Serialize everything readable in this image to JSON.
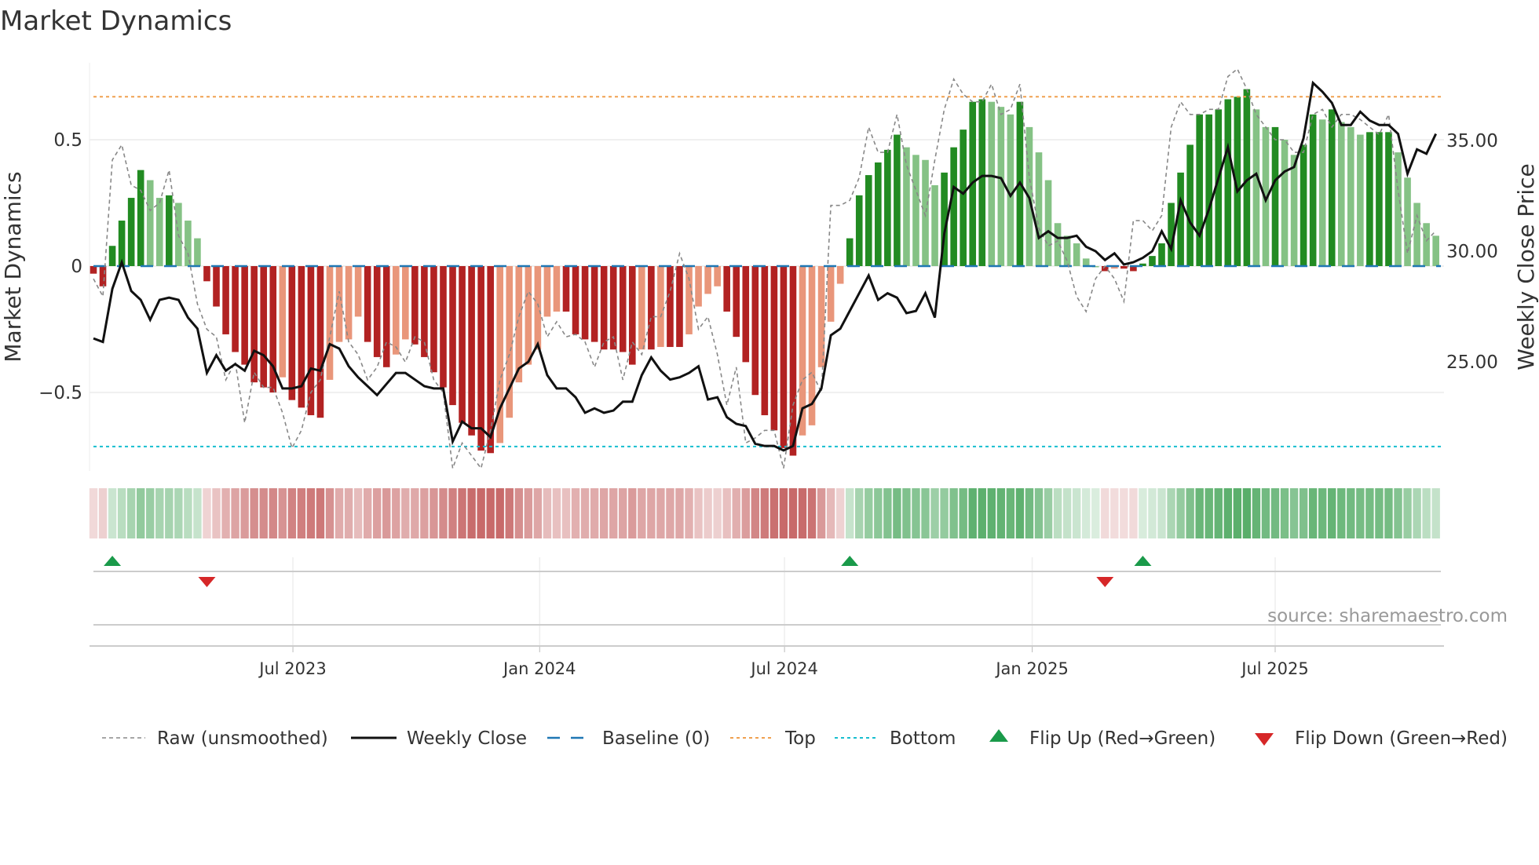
{
  "chart_data": {
    "type": "bar",
    "title": "Market Dynamics",
    "ylabel": "Market Dynamics",
    "y2label": "Weekly Close Price",
    "ylim": [
      -0.82,
      0.82
    ],
    "y2lim": [
      20.5,
      38.4
    ],
    "yticks": [
      {
        "v": 0.5,
        "label": "0.5"
      },
      {
        "v": 0,
        "label": "0"
      },
      {
        "v": -0.5,
        "label": "−0.5"
      }
    ],
    "y2ticks": [
      {
        "v": 35,
        "label": "35.00"
      },
      {
        "v": 30,
        "label": "30.00"
      },
      {
        "v": 25,
        "label": "25.00"
      }
    ],
    "xticks": [
      {
        "week": 21.1,
        "label": "Jul 2023"
      },
      {
        "week": 47.2,
        "label": "Jan 2024"
      },
      {
        "week": 73.1,
        "label": "Jul 2024"
      },
      {
        "week": 99.3,
        "label": "Jan 2025"
      },
      {
        "week": 125.0,
        "label": "Jul 2025"
      }
    ],
    "top": 0.67,
    "bottom": -0.714,
    "momentum": [
      -0.03,
      -0.08,
      0.08,
      0.18,
      0.27,
      0.38,
      0.34,
      0.27,
      0.28,
      0.25,
      0.18,
      0.11,
      -0.06,
      -0.16,
      -0.27,
      -0.34,
      -0.39,
      -0.46,
      -0.48,
      -0.5,
      -0.44,
      -0.53,
      -0.56,
      -0.59,
      -0.6,
      -0.45,
      -0.3,
      -0.29,
      -0.2,
      -0.3,
      -0.36,
      -0.4,
      -0.35,
      -0.29,
      -0.31,
      -0.36,
      -0.42,
      -0.48,
      -0.55,
      -0.62,
      -0.67,
      -0.73,
      -0.74,
      -0.7,
      -0.6,
      -0.46,
      -0.39,
      -0.33,
      -0.2,
      -0.18,
      -0.18,
      -0.27,
      -0.29,
      -0.3,
      -0.33,
      -0.33,
      -0.34,
      -0.39,
      -0.33,
      -0.33,
      -0.32,
      -0.32,
      -0.32,
      -0.27,
      -0.16,
      -0.11,
      -0.08,
      -0.18,
      -0.28,
      -0.38,
      -0.51,
      -0.59,
      -0.65,
      -0.72,
      -0.75,
      -0.67,
      -0.63,
      -0.4,
      -0.22,
      -0.07,
      0.11,
      0.28,
      0.36,
      0.41,
      0.46,
      0.52,
      0.47,
      0.44,
      0.42,
      0.32,
      0.37,
      0.47,
      0.54,
      0.65,
      0.66,
      0.65,
      0.63,
      0.6,
      0.65,
      0.55,
      0.45,
      0.34,
      0.17,
      0.12,
      0.09,
      0.03,
      0.0,
      -0.02,
      -0.01,
      -0.01,
      -0.02,
      0.01,
      0.04,
      0.09,
      0.25,
      0.37,
      0.48,
      0.6,
      0.6,
      0.62,
      0.66,
      0.67,
      0.7,
      0.62,
      0.55,
      0.55,
      0.5,
      0.44,
      0.48,
      0.6,
      0.58,
      0.62,
      0.57,
      0.55,
      0.52,
      0.53,
      0.53,
      0.53,
      0.45,
      0.35,
      0.25,
      0.17,
      0.12
    ],
    "raw": [
      -0.05,
      -0.12,
      0.42,
      0.48,
      0.32,
      0.3,
      0.22,
      0.25,
      0.38,
      0.12,
      0.05,
      -0.15,
      -0.25,
      -0.28,
      -0.45,
      -0.38,
      -0.62,
      -0.42,
      -0.48,
      -0.48,
      -0.58,
      -0.72,
      -0.65,
      -0.5,
      -0.45,
      -0.28,
      -0.1,
      -0.3,
      -0.35,
      -0.45,
      -0.4,
      -0.3,
      -0.32,
      -0.38,
      -0.28,
      -0.3,
      -0.45,
      -0.5,
      -0.8,
      -0.7,
      -0.75,
      -0.8,
      -0.65,
      -0.45,
      -0.35,
      -0.2,
      -0.1,
      -0.15,
      -0.28,
      -0.22,
      -0.28,
      -0.27,
      -0.3,
      -0.4,
      -0.3,
      -0.28,
      -0.45,
      -0.3,
      -0.35,
      -0.2,
      -0.2,
      -0.1,
      0.05,
      -0.05,
      -0.25,
      -0.2,
      -0.35,
      -0.55,
      -0.4,
      -0.7,
      -0.68,
      -0.65,
      -0.65,
      -0.8,
      -0.55,
      -0.45,
      -0.42,
      -0.5,
      0.24,
      0.24,
      0.26,
      0.35,
      0.55,
      0.45,
      0.45,
      0.6,
      0.4,
      0.3,
      0.2,
      0.42,
      0.62,
      0.74,
      0.68,
      0.65,
      0.65,
      0.72,
      0.6,
      0.62,
      0.72,
      0.35,
      0.15,
      0.08,
      0.1,
      0.02,
      -0.12,
      -0.18,
      -0.05,
      0.0,
      -0.05,
      -0.14,
      0.18,
      0.18,
      0.14,
      0.2,
      0.55,
      0.65,
      0.6,
      0.6,
      0.62,
      0.62,
      0.75,
      0.78,
      0.7,
      0.6,
      0.55,
      0.5,
      0.5,
      0.45,
      0.45,
      0.6,
      0.62,
      0.55,
      0.6,
      0.6,
      0.58,
      0.55,
      0.52,
      0.6,
      0.3,
      0.05,
      0.2,
      0.1,
      0.14
    ],
    "close": [
      26.06,
      25.9,
      28.3,
      29.5,
      28.2,
      27.8,
      26.9,
      27.8,
      27.9,
      27.8,
      27.0,
      26.5,
      24.5,
      25.3,
      24.6,
      24.9,
      24.6,
      25.5,
      25.3,
      24.8,
      23.8,
      23.8,
      23.9,
      24.7,
      24.6,
      25.8,
      25.6,
      24.8,
      24.3,
      23.9,
      23.5,
      24.0,
      24.5,
      24.5,
      24.2,
      23.9,
      23.8,
      23.8,
      21.4,
      22.3,
      22.0,
      22.0,
      21.6,
      22.9,
      23.8,
      24.7,
      25.0,
      25.8,
      24.4,
      23.8,
      23.8,
      23.4,
      22.7,
      22.9,
      22.7,
      22.8,
      23.2,
      23.2,
      24.4,
      25.2,
      24.6,
      24.2,
      24.3,
      24.5,
      24.8,
      23.3,
      23.4,
      22.5,
      22.2,
      22.1,
      21.3,
      21.2,
      21.2,
      21.0,
      21.2,
      22.9,
      23.1,
      23.8,
      26.2,
      26.5,
      27.3,
      28.1,
      28.9,
      27.8,
      28.1,
      27.9,
      27.2,
      27.3,
      28.1,
      27.0,
      30.8,
      32.9,
      32.6,
      33.1,
      33.4,
      33.4,
      33.3,
      32.5,
      33.1,
      32.4,
      30.6,
      30.9,
      30.6,
      30.6,
      30.7,
      30.2,
      30.0,
      29.6,
      29.9,
      29.4,
      29.5,
      29.7,
      30.0,
      30.9,
      30.1,
      32.3,
      31.3,
      30.7,
      31.9,
      33.3,
      34.7,
      32.7,
      33.2,
      33.5,
      32.3,
      33.2,
      33.6,
      33.8,
      35.1,
      37.6,
      37.2,
      36.7,
      35.7,
      35.7,
      36.3,
      35.9,
      35.7,
      35.7,
      35.3,
      33.5,
      34.6,
      34.4,
      35.3
    ],
    "flip_up_weeks": [
      2,
      80,
      111
    ],
    "flip_down_weeks": [
      12,
      107
    ],
    "legend": {
      "position": "bottom",
      "items": [
        "Raw (unsmoothed)",
        "Weekly Close",
        "Baseline (0)",
        "Top",
        "Bottom",
        "Flip Up (Red→Green)",
        "Flip Down (Green→Red)"
      ]
    },
    "source": "source: sharemaestro.com"
  },
  "colors": {
    "dark_green": "#228b22",
    "light_green": "#85c285",
    "dark_red": "#b22222",
    "light_red": "#e9967a",
    "top": "#f0a050",
    "bottom": "#17becf",
    "baseline": "#1f77b4",
    "flip_up": "#1a9a4a",
    "flip_down": "#d62728"
  }
}
